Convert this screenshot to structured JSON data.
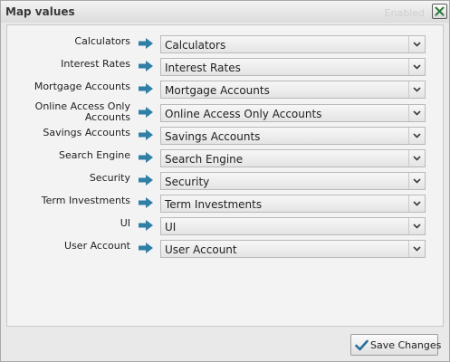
{
  "dialog": {
    "title": "Map values",
    "ghost_status": "Enabled",
    "save_label": "Save Changes"
  },
  "mappings": [
    {
      "label": "Calculators",
      "value": "Calculators"
    },
    {
      "label": "Interest Rates",
      "value": "Interest Rates"
    },
    {
      "label": "Mortgage Accounts",
      "value": "Mortgage Accounts"
    },
    {
      "label": "Online Access Only Accounts",
      "value": "Online Access Only Accounts"
    },
    {
      "label": "Savings Accounts",
      "value": "Savings Accounts"
    },
    {
      "label": "Search Engine",
      "value": "Search Engine"
    },
    {
      "label": "Security",
      "value": "Security"
    },
    {
      "label": "Term Investments",
      "value": "Term Investments"
    },
    {
      "label": "UI",
      "value": "UI"
    },
    {
      "label": "User Account",
      "value": "User Account"
    }
  ],
  "colors": {
    "arrow": "#2f7fa6",
    "check": "#2a6e9a",
    "close_x": "#2c7a3a"
  },
  "icons": {
    "close": "close-icon",
    "arrow": "arrow-right-icon",
    "dropdown": "chevron-down-icon",
    "save": "checkmark-icon"
  }
}
